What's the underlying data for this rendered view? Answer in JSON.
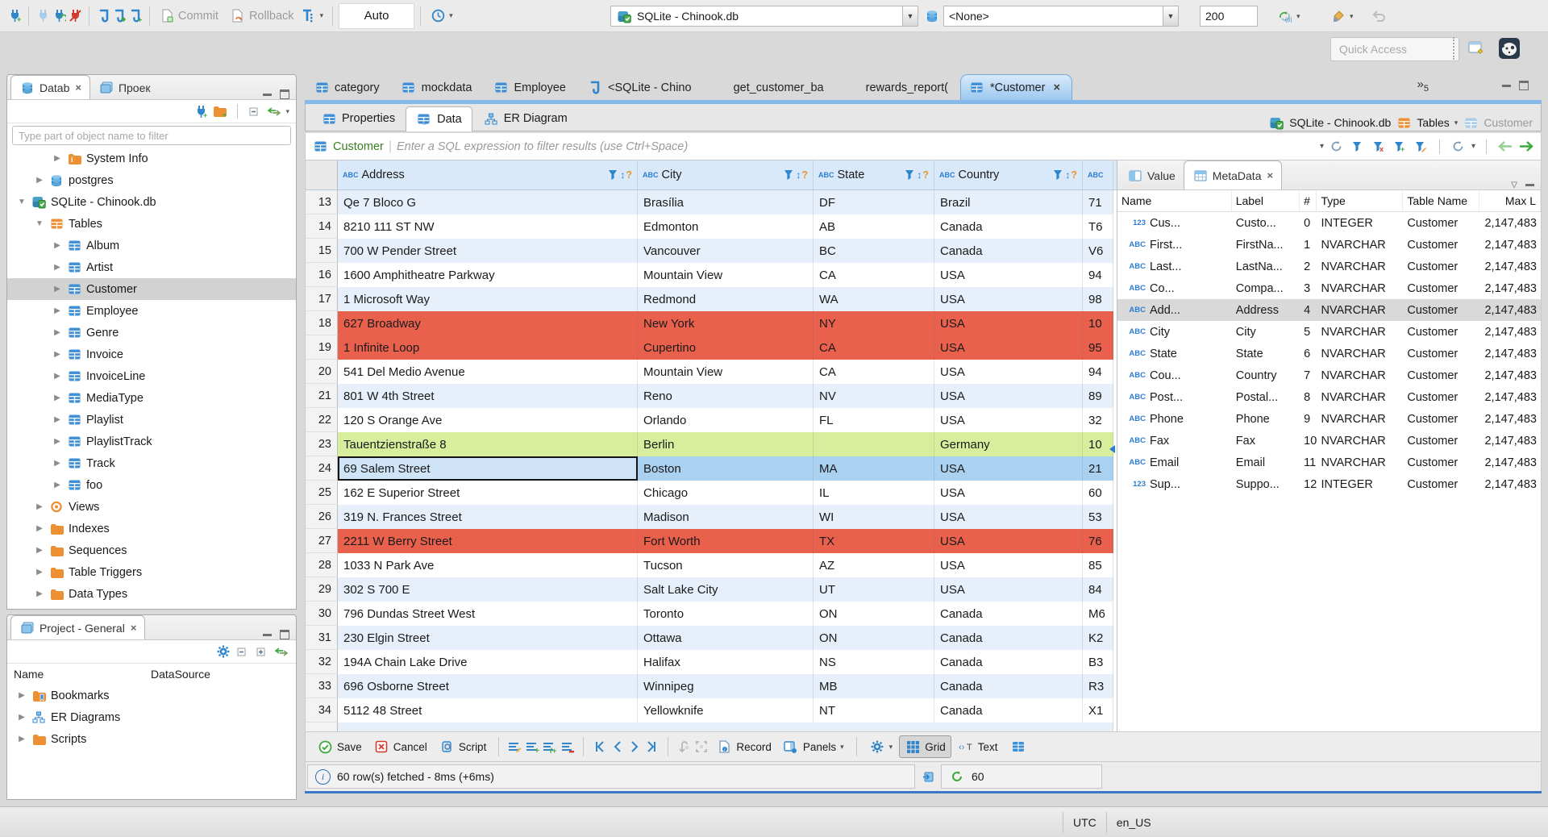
{
  "toolbar": {
    "commit": "Commit",
    "rollback": "Rollback",
    "auto": "Auto",
    "connection": "SQLite - Chinook.db",
    "schema": "<None>",
    "fetch_size": "200",
    "quick_access": "Quick Access"
  },
  "sidebar": {
    "navigator": {
      "tab_db": "Datab",
      "tab_proj": "Проек",
      "filter_placeholder": "Type part of object name to filter",
      "tree": [
        {
          "d": 2,
          "ar": "r",
          "ic": "folder-info",
          "lb": "System Info"
        },
        {
          "d": 1,
          "ar": "r",
          "ic": "db",
          "lb": "postgres"
        },
        {
          "d": 0,
          "ar": "d",
          "ic": "sqlite",
          "lb": "SQLite - Chinook.db"
        },
        {
          "d": 1,
          "ar": "d",
          "ic": "table-orange",
          "lb": "Tables"
        },
        {
          "d": 2,
          "ar": "r",
          "ic": "table-blue",
          "lb": "Album"
        },
        {
          "d": 2,
          "ar": "r",
          "ic": "table-blue",
          "lb": "Artist"
        },
        {
          "d": 2,
          "ar": "r",
          "ic": "table-blue",
          "lb": "Customer",
          "sel": true
        },
        {
          "d": 2,
          "ar": "r",
          "ic": "table-blue",
          "lb": "Employee"
        },
        {
          "d": 2,
          "ar": "r",
          "ic": "table-blue",
          "lb": "Genre"
        },
        {
          "d": 2,
          "ar": "r",
          "ic": "table-blue",
          "lb": "Invoice"
        },
        {
          "d": 2,
          "ar": "r",
          "ic": "table-blue",
          "lb": "InvoiceLine"
        },
        {
          "d": 2,
          "ar": "r",
          "ic": "table-blue",
          "lb": "MediaType"
        },
        {
          "d": 2,
          "ar": "r",
          "ic": "table-blue",
          "lb": "Playlist"
        },
        {
          "d": 2,
          "ar": "r",
          "ic": "table-blue",
          "lb": "PlaylistTrack"
        },
        {
          "d": 2,
          "ar": "r",
          "ic": "table-blue",
          "lb": "Track"
        },
        {
          "d": 2,
          "ar": "r",
          "ic": "table-blue",
          "lb": "foo"
        },
        {
          "d": 1,
          "ar": "r",
          "ic": "eye",
          "lb": "Views"
        },
        {
          "d": 1,
          "ar": "r",
          "ic": "folder",
          "lb": "Indexes"
        },
        {
          "d": 1,
          "ar": "r",
          "ic": "folder",
          "lb": "Sequences"
        },
        {
          "d": 1,
          "ar": "r",
          "ic": "folder",
          "lb": "Table Triggers"
        },
        {
          "d": 1,
          "ar": "r",
          "ic": "folder",
          "lb": "Data Types"
        }
      ]
    },
    "project": {
      "tab": "Project - General",
      "col_name": "Name",
      "col_datasource": "DataSource",
      "items": [
        {
          "ic": "folder-bookmark",
          "lb": "Bookmarks"
        },
        {
          "ic": "er",
          "lb": "ER Diagrams"
        },
        {
          "ic": "folder",
          "lb": "Scripts"
        }
      ]
    }
  },
  "editor": {
    "tabs": [
      {
        "ic": "table-blue",
        "lb": "category"
      },
      {
        "ic": "table-blue",
        "lb": "mockdata"
      },
      {
        "ic": "table-blue",
        "lb": "Employee"
      },
      {
        "ic": "sqlpage",
        "lb": "<SQLite - Chino"
      },
      {
        "ic": "script",
        "lb": "get_customer_ba"
      },
      {
        "ic": "func",
        "lb": "rewards_report("
      },
      {
        "ic": "table-blue",
        "lb": "*Customer",
        "active": true
      }
    ],
    "overflow": "5"
  },
  "view_tabs": [
    {
      "ic": "table-blue",
      "lb": "Properties"
    },
    {
      "ic": "gridcode",
      "lb": "Data",
      "active": true
    },
    {
      "ic": "er",
      "lb": "ER Diagram"
    }
  ],
  "breadcrumb": {
    "db": "SQLite - Chinook.db",
    "group": "Tables",
    "table": "Customer"
  },
  "filterbar": {
    "table": "Customer",
    "placeholder": "Enter a SQL expression to filter results (use Ctrl+Space)"
  },
  "grid": {
    "columns": [
      "Address",
      "City",
      "State",
      "Country",
      ""
    ],
    "rows": [
      {
        "n": "13",
        "a": "Qe 7 Bloco G",
        "c": "Brasília",
        "s": "DF",
        "co": "Brazil",
        "x": "71",
        "v": "blue"
      },
      {
        "n": "14",
        "a": "8210 111 ST NW",
        "c": "Edmonton",
        "s": "AB",
        "co": "Canada",
        "x": "T6",
        "v": "white"
      },
      {
        "n": "15",
        "a": "700 W Pender Street",
        "c": "Vancouver",
        "s": "BC",
        "co": "Canada",
        "x": "V6",
        "v": "blue"
      },
      {
        "n": "16",
        "a": "1600 Amphitheatre Parkway",
        "c": "Mountain View",
        "s": "CA",
        "co": "USA",
        "x": "94",
        "v": "white"
      },
      {
        "n": "17",
        "a": "1 Microsoft Way",
        "c": "Redmond",
        "s": "WA",
        "co": "USA",
        "x": "98",
        "v": "blue"
      },
      {
        "n": "18",
        "a": "627 Broadway",
        "c": "New York",
        "s": "NY",
        "co": "USA",
        "x": "10",
        "v": "red"
      },
      {
        "n": "19",
        "a": "1 Infinite Loop",
        "c": "Cupertino",
        "s": "CA",
        "co": "USA",
        "x": "95",
        "v": "red"
      },
      {
        "n": "20",
        "a": "541 Del Medio Avenue",
        "c": "Mountain View",
        "s": "CA",
        "co": "USA",
        "x": "94",
        "v": "white"
      },
      {
        "n": "21",
        "a": "801 W 4th Street",
        "c": "Reno",
        "s": "NV",
        "co": "USA",
        "x": "89",
        "v": "blue"
      },
      {
        "n": "22",
        "a": "120 S Orange Ave",
        "c": "Orlando",
        "s": "FL",
        "co": "USA",
        "x": "32",
        "v": "white"
      },
      {
        "n": "23",
        "a": "Tauentzienstraße 8",
        "c": "Berlin",
        "s": "",
        "co": "Germany",
        "x": "10",
        "v": "green"
      },
      {
        "n": "24",
        "a": "69 Salem Street",
        "c": "Boston",
        "s": "MA",
        "co": "USA",
        "x": "21",
        "v": "sel",
        "focus": true
      },
      {
        "n": "25",
        "a": "162 E Superior Street",
        "c": "Chicago",
        "s": "IL",
        "co": "USA",
        "x": "60",
        "v": "white"
      },
      {
        "n": "26",
        "a": "319 N. Frances Street",
        "c": "Madison",
        "s": "WI",
        "co": "USA",
        "x": "53",
        "v": "blue"
      },
      {
        "n": "27",
        "a": "2211 W Berry Street",
        "c": "Fort Worth",
        "s": "TX",
        "co": "USA",
        "x": "76",
        "v": "red"
      },
      {
        "n": "28",
        "a": "1033 N Park Ave",
        "c": "Tucson",
        "s": "AZ",
        "co": "USA",
        "x": "85",
        "v": "white"
      },
      {
        "n": "29",
        "a": "302 S 700 E",
        "c": "Salt Lake City",
        "s": "UT",
        "co": "USA",
        "x": "84",
        "v": "blue"
      },
      {
        "n": "30",
        "a": "796 Dundas Street West",
        "c": "Toronto",
        "s": "ON",
        "co": "Canada",
        "x": "M6",
        "v": "white"
      },
      {
        "n": "31",
        "a": "230 Elgin Street",
        "c": "Ottawa",
        "s": "ON",
        "co": "Canada",
        "x": "K2",
        "v": "blue"
      },
      {
        "n": "32",
        "a": "194A Chain Lake Drive",
        "c": "Halifax",
        "s": "NS",
        "co": "Canada",
        "x": "B3",
        "v": "white"
      },
      {
        "n": "33",
        "a": "696 Osborne Street",
        "c": "Winnipeg",
        "s": "MB",
        "co": "Canada",
        "x": "R3",
        "v": "blue"
      },
      {
        "n": "34",
        "a": "5112 48 Street",
        "c": "Yellowknife",
        "s": "NT",
        "co": "Canada",
        "x": "X1",
        "v": "white"
      }
    ]
  },
  "meta": {
    "tab_value": "Value",
    "tab_meta": "MetaData",
    "columns": [
      "Name",
      "Label",
      "#",
      "Type",
      "Table Name",
      "Max L"
    ],
    "rows": [
      {
        "t": "123",
        "n": "Cus...",
        "l": "Custo...",
        "i": "0",
        "ty": "INTEGER",
        "tb": "Customer",
        "m": "2,147,483"
      },
      {
        "t": "ABC",
        "n": "First...",
        "l": "FirstNa...",
        "i": "1",
        "ty": "NVARCHAR",
        "tb": "Customer",
        "m": "2,147,483"
      },
      {
        "t": "ABC",
        "n": "Last...",
        "l": "LastNa...",
        "i": "2",
        "ty": "NVARCHAR",
        "tb": "Customer",
        "m": "2,147,483"
      },
      {
        "t": "ABC",
        "n": "Co...",
        "l": "Compa...",
        "i": "3",
        "ty": "NVARCHAR",
        "tb": "Customer",
        "m": "2,147,483"
      },
      {
        "t": "ABC",
        "n": "Add...",
        "l": "Address",
        "i": "4",
        "ty": "NVARCHAR",
        "tb": "Customer",
        "m": "2,147,483",
        "sel": true
      },
      {
        "t": "ABC",
        "n": "City",
        "l": "City",
        "i": "5",
        "ty": "NVARCHAR",
        "tb": "Customer",
        "m": "2,147,483"
      },
      {
        "t": "ABC",
        "n": "State",
        "l": "State",
        "i": "6",
        "ty": "NVARCHAR",
        "tb": "Customer",
        "m": "2,147,483"
      },
      {
        "t": "ABC",
        "n": "Cou...",
        "l": "Country",
        "i": "7",
        "ty": "NVARCHAR",
        "tb": "Customer",
        "m": "2,147,483"
      },
      {
        "t": "ABC",
        "n": "Post...",
        "l": "Postal...",
        "i": "8",
        "ty": "NVARCHAR",
        "tb": "Customer",
        "m": "2,147,483"
      },
      {
        "t": "ABC",
        "n": "Phone",
        "l": "Phone",
        "i": "9",
        "ty": "NVARCHAR",
        "tb": "Customer",
        "m": "2,147,483"
      },
      {
        "t": "ABC",
        "n": "Fax",
        "l": "Fax",
        "i": "10",
        "ty": "NVARCHAR",
        "tb": "Customer",
        "m": "2,147,483"
      },
      {
        "t": "ABC",
        "n": "Email",
        "l": "Email",
        "i": "11",
        "ty": "NVARCHAR",
        "tb": "Customer",
        "m": "2,147,483"
      },
      {
        "t": "123",
        "n": "Sup...",
        "l": "Suppo...",
        "i": "12",
        "ty": "INTEGER",
        "tb": "Customer",
        "m": "2,147,483"
      }
    ]
  },
  "result_toolbar": {
    "save": "Save",
    "cancel": "Cancel",
    "script": "Script",
    "record": "Record",
    "panels": "Panels",
    "grid": "Grid",
    "text": "Text"
  },
  "status": {
    "message": "60 row(s) fetched - 8ms (+6ms)",
    "count": "60"
  },
  "statusbar": {
    "tz": "UTC",
    "locale": "en_US"
  }
}
